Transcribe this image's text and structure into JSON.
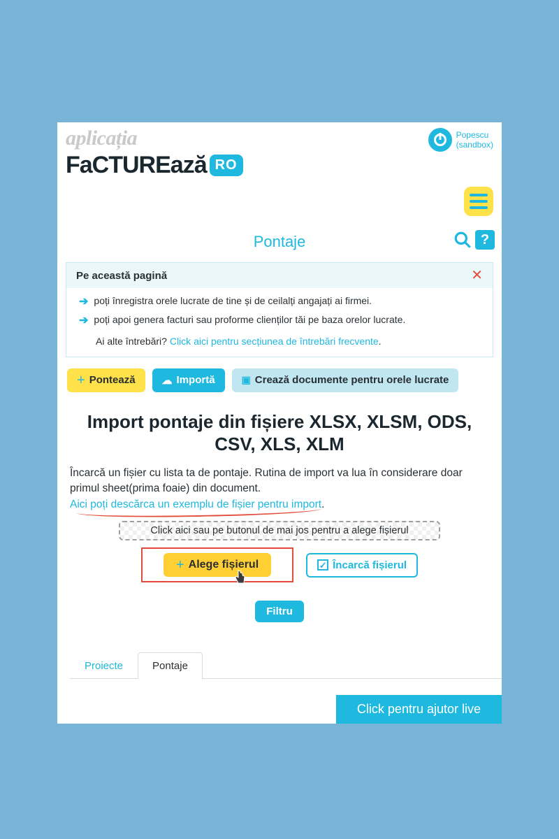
{
  "logo": {
    "top": "aplicația",
    "word": "FaCTUREază",
    "badge": "RO"
  },
  "user": {
    "name": "Popescu",
    "env": "(sandbox)"
  },
  "page_title": "Pontaje",
  "help_glyph": "?",
  "info": {
    "title": "Pe această pagină",
    "line1": "poți înregistra orele lucrate de tine și de ceilalți angajați ai firmei.",
    "line2": "poți apoi genera facturi sau proforme clienților tăi pe baza orelor lucrate.",
    "q_prefix": "Ai alte întrebări? ",
    "q_link": "Click aici pentru secțiunea de întrebări frecvente",
    "q_suffix": "."
  },
  "buttons": {
    "ponteaza": "Pontează",
    "importa": "Importă",
    "creaza": "Crează documente pentru orele lucrate",
    "alege": "Alege fișierul",
    "incarca": "Încarcă fișierul",
    "filtru": "Filtru"
  },
  "section": {
    "heading": "Import pontaje din fișiere XLSX, XLSM, ODS, CSV, XLS, XLM",
    "para_a": "Încarcă un fișier cu lista ta de pontaje. Rutina de import va lua în considerare doar primul sheet(prima foaie) din document. ",
    "para_link": "Aici poți descărca un exemplu de fișier pentru import",
    "para_b": ".",
    "drop_hint": "Click aici sau pe butonul de mai jos pentru a alege fișierul"
  },
  "tabs": {
    "proiecte": "Proiecte",
    "pontaje": "Pontaje"
  },
  "live_help": "Click pentru ajutor live"
}
